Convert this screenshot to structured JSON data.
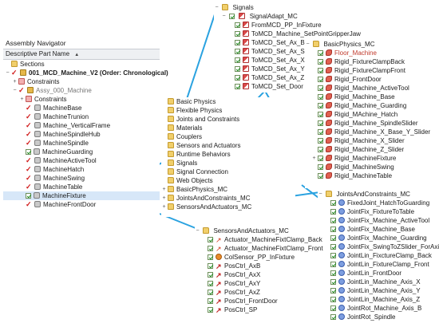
{
  "colors": {
    "connector": "#2aa2e0",
    "selection": "#d7e7f8",
    "check_red": "#d01818"
  },
  "navigator": {
    "title": "Assembly Navigator",
    "column_header": "Descriptive Part Name",
    "rows": [
      {
        "label": "Sections",
        "icon": "folder",
        "indent": 0,
        "expander": "",
        "check": "none"
      },
      {
        "label": "001_MCD_Machine_V2 (Order: Chronological)",
        "icon": "assy",
        "indent": 0,
        "expander": "−",
        "check": "red",
        "bold": true
      },
      {
        "label": "Constraints",
        "icon": "constraint",
        "indent": 1,
        "expander": "+",
        "check": "none"
      },
      {
        "label": "Assy_000_Machine",
        "icon": "assy",
        "indent": 1,
        "expander": "−",
        "check": "red",
        "grey": true
      },
      {
        "label": "Constraints",
        "icon": "constraint",
        "indent": 2,
        "expander": "+",
        "check": "none"
      },
      {
        "label": "MachineBase",
        "icon": "part",
        "indent": 2,
        "expander": "",
        "check": "red"
      },
      {
        "label": "MachineTrunion",
        "icon": "part",
        "indent": 2,
        "expander": "",
        "check": "red"
      },
      {
        "label": "Machine_VerticalFrame",
        "icon": "part",
        "indent": 2,
        "expander": "",
        "check": "red"
      },
      {
        "label": "MachineSpindleHub",
        "icon": "part",
        "indent": 2,
        "expander": "",
        "check": "red"
      },
      {
        "label": "MachineSpindle",
        "icon": "part",
        "indent": 2,
        "expander": "",
        "check": "red"
      },
      {
        "label": "MachineGuarding",
        "icon": "part",
        "indent": 2,
        "expander": "",
        "check": "box"
      },
      {
        "label": "MachineActiveTool",
        "icon": "part",
        "indent": 2,
        "expander": "",
        "check": "red"
      },
      {
        "label": "MachineHatch",
        "icon": "part",
        "indent": 2,
        "expander": "",
        "check": "red"
      },
      {
        "label": "MachineSwing",
        "icon": "part",
        "indent": 2,
        "expander": "",
        "check": "red"
      },
      {
        "label": "MachineTable",
        "icon": "part",
        "indent": 2,
        "expander": "",
        "check": "red"
      },
      {
        "label": "MachineFixture",
        "icon": "part",
        "indent": 2,
        "expander": "",
        "check": "box",
        "selected": true
      },
      {
        "label": "MachineFrontDoor",
        "icon": "part",
        "indent": 2,
        "expander": "",
        "check": "red"
      }
    ]
  },
  "physics_navigator": {
    "rows": [
      {
        "label": "Basic Physics",
        "icon": "folder",
        "indent": 0
      },
      {
        "label": "Flexible Physics",
        "icon": "folder",
        "indent": 0
      },
      {
        "label": "Joints and Constraints",
        "icon": "folder",
        "indent": 0
      },
      {
        "label": "Materials",
        "icon": "folder",
        "indent": 0
      },
      {
        "label": "Couplers",
        "icon": "folder",
        "indent": 0
      },
      {
        "label": "Sensors and Actuators",
        "icon": "folder",
        "indent": 0
      },
      {
        "label": "Runtime Behaviors",
        "icon": "folder",
        "indent": 0
      },
      {
        "label": "Signals",
        "icon": "folder",
        "indent": 0
      },
      {
        "label": "Signal Connection",
        "icon": "folder",
        "indent": 0
      },
      {
        "label": "Web Objects",
        "icon": "folder",
        "indent": 0
      },
      {
        "label": "BasicPhysics_MC",
        "icon": "folder",
        "indent": 0,
        "expander": "+"
      },
      {
        "label": "JointsAndConstraints_MC",
        "icon": "folder",
        "indent": 0,
        "expander": "+"
      },
      {
        "label": "SensorsAndActuators_MC",
        "icon": "folder",
        "indent": 0,
        "expander": "+"
      }
    ]
  },
  "signals_panel": {
    "title": "Signals",
    "adapter": "SignalAdapt_MC",
    "rows": [
      {
        "label": "FromMCD_PP_InFixture",
        "icon": "signal"
      },
      {
        "label": "ToMCD_Machine_SetPointGripperJaw",
        "icon": "signal"
      },
      {
        "label": "ToMCD_Set_Ax_B",
        "icon": "signal"
      },
      {
        "label": "ToMCD_Set_Ax_SP",
        "icon": "signal"
      },
      {
        "label": "ToMCD_Set_Ax_X",
        "icon": "signal"
      },
      {
        "label": "ToMCD_Set_Ax_Y",
        "icon": "signal"
      },
      {
        "label": "ToMCD_Set_Ax_Z",
        "icon": "signal"
      },
      {
        "label": "ToMCD_Set_Door",
        "icon": "signal"
      }
    ]
  },
  "basic_physics_panel": {
    "title": "BasicPhysics_MC",
    "rows": [
      {
        "label": "Floor_Machine",
        "icon": "body",
        "color_red": true
      },
      {
        "label": "Rigid_FixtureClampBack",
        "icon": "body"
      },
      {
        "label": "Rigid_FixtureClampFront",
        "icon": "body"
      },
      {
        "label": "Rigid_FrontDoor",
        "icon": "body"
      },
      {
        "label": "Rigid_Machine_ActiveTool",
        "icon": "body"
      },
      {
        "label": "Rigid_Machine_Base",
        "icon": "body"
      },
      {
        "label": "Rigid_Machine_Guarding",
        "icon": "body"
      },
      {
        "label": "Rigid_MAchine_Hatch",
        "icon": "body"
      },
      {
        "label": "Rigid_Machine_SpindleSlider",
        "icon": "body"
      },
      {
        "label": "Rigid_Machine_X_Base_Y_Slider",
        "icon": "body"
      },
      {
        "label": "Rigid_Machine_X_Slider",
        "icon": "body"
      },
      {
        "label": "Rigid_Machine_Z_Slider",
        "icon": "body"
      },
      {
        "label": "Rigid_MachineFixture",
        "icon": "body",
        "expander": "+"
      },
      {
        "label": "Rigid_MachineSwing",
        "icon": "body"
      },
      {
        "label": "Rigid_MachineTable",
        "icon": "body"
      }
    ]
  },
  "joints_panel": {
    "title": "JointsAndConstraints_MC",
    "rows": [
      {
        "label": "FixedJoint_HatchToGuarding",
        "icon": "joint"
      },
      {
        "label": "JointFix_FixtureToTable",
        "icon": "joint"
      },
      {
        "label": "JointFix_Machine_ActiveTool",
        "icon": "joint"
      },
      {
        "label": "JointFix_Machine_Base",
        "icon": "joint"
      },
      {
        "label": "JointFix_Machine_Guarding",
        "icon": "joint"
      },
      {
        "label": "JointFix_SwingToZSlider_ForAxis",
        "icon": "joint"
      },
      {
        "label": "JointLin_FixctureClamp_Back",
        "icon": "joint"
      },
      {
        "label": "JointLin_FixtureClamp_Front",
        "icon": "joint"
      },
      {
        "label": "JointLin_FrontDoor",
        "icon": "joint"
      },
      {
        "label": "JointLin_Machine_Axis_X",
        "icon": "joint"
      },
      {
        "label": "JointLin_Machine_Axis_Y",
        "icon": "joint"
      },
      {
        "label": "JointLin_Machine_Axis_Z",
        "icon": "joint"
      },
      {
        "label": "JointRot_Machine_Axis_B",
        "icon": "joint"
      },
      {
        "label": "JointRot_Spindle",
        "icon": "joint"
      }
    ]
  },
  "sensors_panel": {
    "title": "SensorsAndActuators_MC",
    "rows": [
      {
        "label": "Actuator_MachineFixtClamp_Back",
        "icon": "actuator"
      },
      {
        "label": "Actuator_MachineFixtClamp_Front",
        "icon": "actuator"
      },
      {
        "label": "ColSensor_PP_InFixture",
        "icon": "sensor"
      },
      {
        "label": "PosCtrl_AxB",
        "icon": "posctrl"
      },
      {
        "label": "PosCtrl_AxX",
        "icon": "posctrl"
      },
      {
        "label": "PosCtrl_AxY",
        "icon": "posctrl"
      },
      {
        "label": "PosCtrl_AxZ",
        "icon": "posctrl"
      },
      {
        "label": "PosCtrl_FrontDoor",
        "icon": "posctrl"
      },
      {
        "label": "PosCtrl_SP",
        "icon": "posctrl"
      }
    ]
  }
}
